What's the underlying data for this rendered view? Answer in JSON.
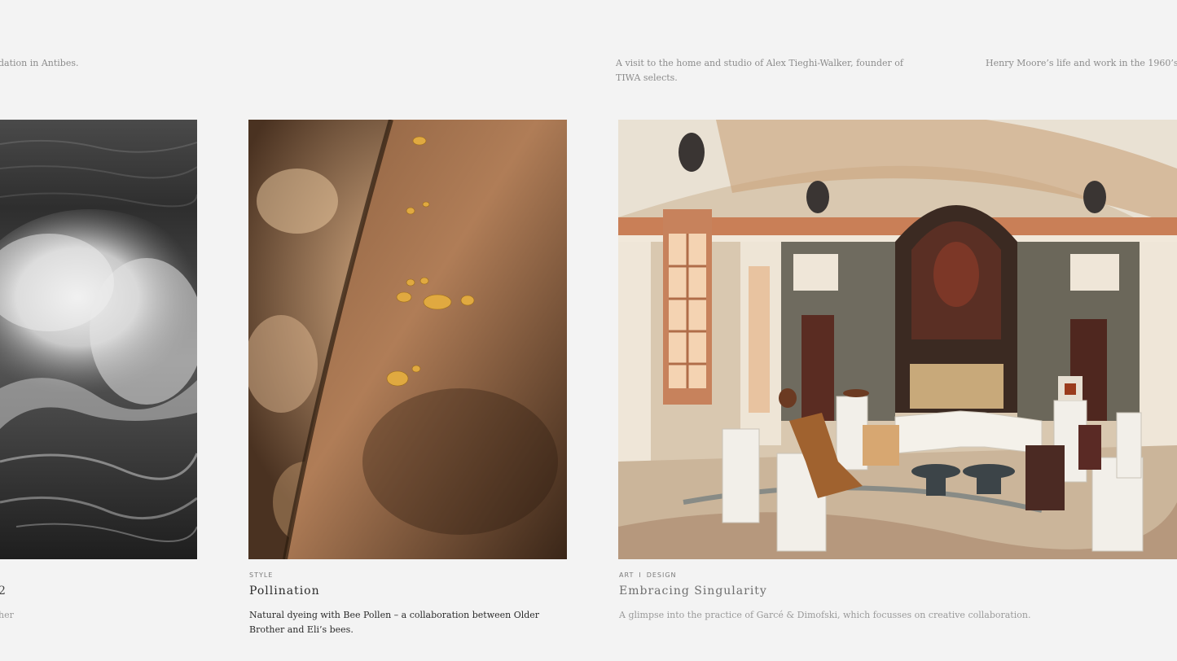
{
  "top_excerpts": {
    "col1": "dation in Antibes.",
    "col3": "A visit to the home and studio of Alex Tieghi-Walker, founder of TIWA selects.",
    "col4": "Henry Moore’s life and work in the 1960’s"
  },
  "cards": {
    "c1": {
      "title": "2",
      "description": "her"
    },
    "c2": {
      "tags": [
        "STYLE"
      ],
      "title": "Pollination",
      "description": "Natural dyeing with Bee Pollen – a collaboration between Older Brother and Eli’s bees."
    },
    "c3": {
      "tags": [
        "ART",
        "DESIGN"
      ],
      "tag_separator": "I",
      "title": "Embracing Singularity",
      "description": "A glimpse into the practice of Garcé & Dimofski, which focusses on creative collaboration."
    }
  },
  "colors": {
    "background": "#f3f3f3",
    "muted_text": "#9a9a9a",
    "body_text": "#2b2b2b"
  }
}
